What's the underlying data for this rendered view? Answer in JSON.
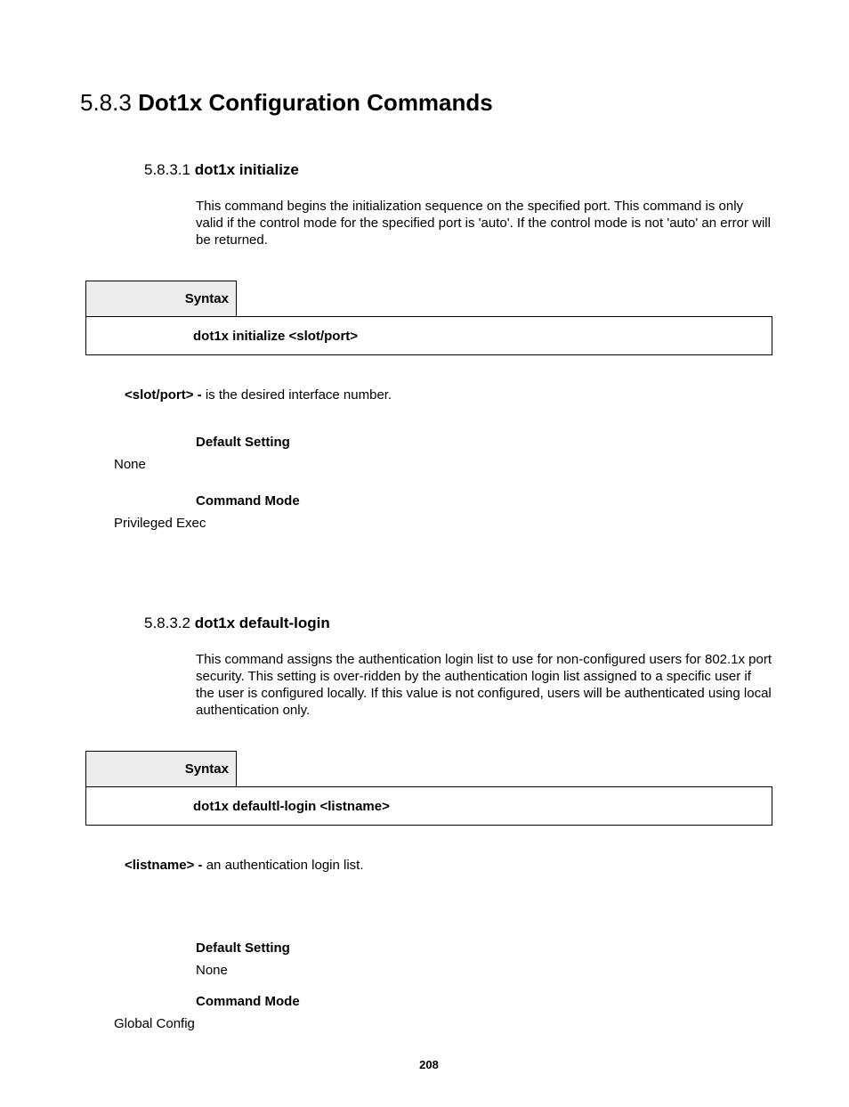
{
  "section": {
    "number": "5.8.3",
    "title": "Dot1x Configuration Commands"
  },
  "commands": [
    {
      "number": "5.8.3.1",
      "title": "dot1x initialize",
      "description": "This command begins the initialization sequence on the specified port. This command is only valid if the control mode for the specified port is 'auto'. If the control mode is not 'auto' an error will be returned.",
      "syntax_label": "Syntax",
      "syntax_text": "dot1x initialize <slot/port>",
      "param_name": "<slot/port> - ",
      "param_desc": "is the desired interface number.",
      "default_label": "Default Setting",
      "default_value": "None",
      "mode_label": "Command Mode",
      "mode_value": "Privileged Exec"
    },
    {
      "number": "5.8.3.2",
      "title": "dot1x default-login",
      "description": "This command assigns the authentication login list to use for non-configured users for 802.1x port security. This setting is over-ridden by the authentication login list assigned to a specific user if the user is configured locally. If this value is not configured, users will be authenticated using local authentication only.",
      "syntax_label": "Syntax",
      "syntax_text": "dot1x defaultl-login <listname>",
      "param_name": "<listname> - ",
      "param_desc": "an authentication login list.",
      "default_label": "Default Setting",
      "default_value": "None",
      "mode_label": "Command Mode",
      "mode_value": "Global Config"
    }
  ],
  "page_number": "208"
}
